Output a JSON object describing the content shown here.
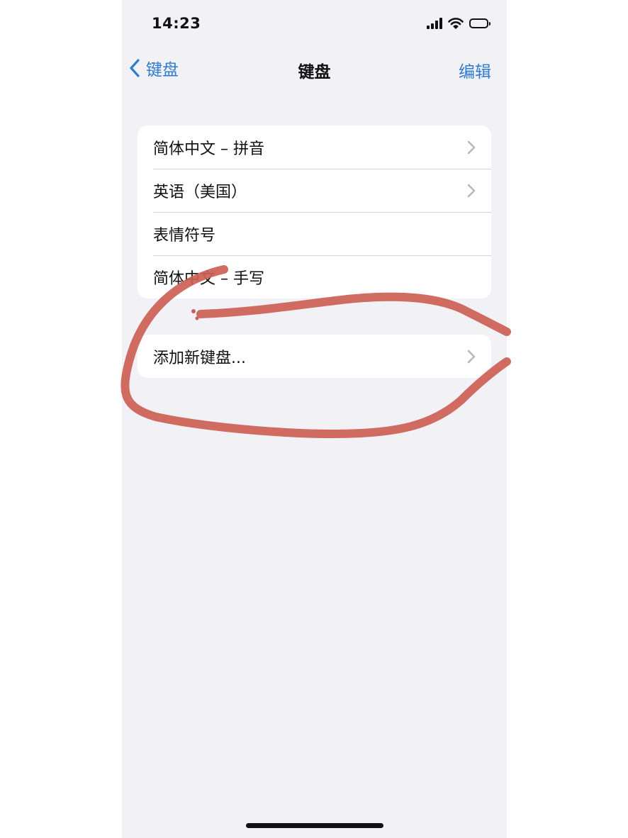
{
  "status_bar": {
    "time": "14:23"
  },
  "nav": {
    "back_label": "键盘",
    "title": "键盘",
    "edit_label": "编辑"
  },
  "keyboards": [
    {
      "label": "简体中文 – 拼音",
      "has_chevron": true
    },
    {
      "label": "英语（美国）",
      "has_chevron": true
    },
    {
      "label": "表情符号",
      "has_chevron": false
    },
    {
      "label": "简体中文 – 手写",
      "has_chevron": false
    }
  ],
  "add_keyboard": {
    "label": "添加新键盘..."
  },
  "colors": {
    "accent": "#2f7bd2",
    "background": "#f2f1f6",
    "annotation": "#cd5f55"
  },
  "icons": [
    "chevron-left-icon",
    "chevron-right-icon",
    "cellular-signal-icon",
    "wifi-icon",
    "battery-icon"
  ]
}
